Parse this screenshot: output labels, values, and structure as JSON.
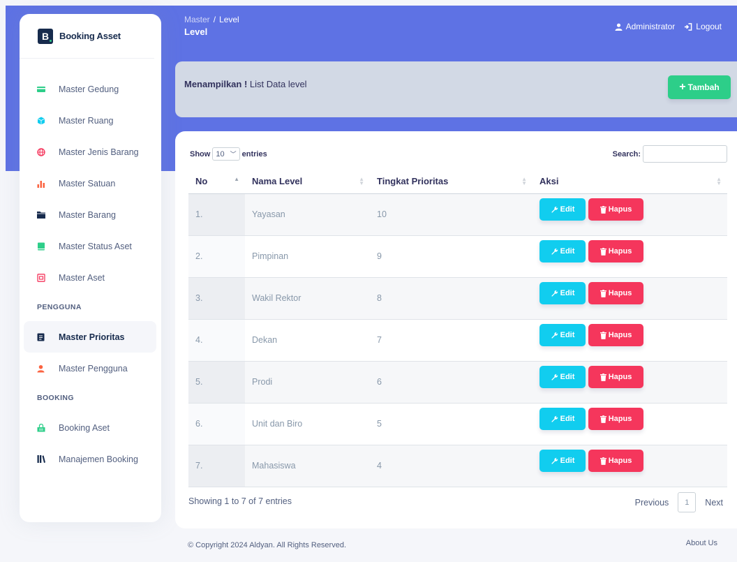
{
  "brand": {
    "letter": "B",
    "name": "Booking Asset"
  },
  "sidebar": {
    "items": [
      {
        "label": "Master Gedung",
        "icon": "credit-card-icon",
        "color": "#2dce89"
      },
      {
        "label": "Master Ruang",
        "icon": "cube-icon",
        "color": "#11cdef"
      },
      {
        "label": "Master Jenis Barang",
        "icon": "globe-icon",
        "color": "#f5365c"
      },
      {
        "label": "Master Satuan",
        "icon": "bar-chart-icon",
        "color": "#fb6340"
      },
      {
        "label": "Master Barang",
        "icon": "folder-icon",
        "color": "#172b4d"
      },
      {
        "label": "Master Status Aset",
        "icon": "book-icon",
        "color": "#2dce89"
      },
      {
        "label": "Master Aset",
        "icon": "archive-icon",
        "color": "#f5365c"
      }
    ],
    "heading_pengguna": "PENGGUNA",
    "pengguna_items": [
      {
        "label": "Master Prioritas",
        "icon": "clipboard-icon",
        "color": "#172b4d",
        "active": true
      },
      {
        "label": "Master Pengguna",
        "icon": "user-icon",
        "color": "#fb6340"
      }
    ],
    "heading_booking": "BOOKING",
    "booking_items": [
      {
        "label": "Booking Aset",
        "icon": "basket-icon",
        "color": "#2dce89"
      },
      {
        "label": "Manajemen Booking",
        "icon": "library-icon",
        "color": "#172b4d"
      }
    ]
  },
  "header": {
    "breadcrumb_root": "Master",
    "breadcrumb_sep": "/",
    "breadcrumb_current": "Level",
    "title": "Level",
    "user": "Administrator",
    "logout": "Logout"
  },
  "info": {
    "bold": "Menampilkan !",
    "text": " List Data level",
    "add_label": "Tambah"
  },
  "datatable": {
    "show": "Show",
    "length": "10",
    "entries": "entries",
    "search_label": "Search:",
    "columns": [
      "No",
      "Nama Level",
      "Tingkat Prioritas",
      "Aksi"
    ],
    "rows": [
      {
        "no": "1.",
        "nama": "Yayasan",
        "prioritas": "10"
      },
      {
        "no": "2.",
        "nama": "Pimpinan",
        "prioritas": "9"
      },
      {
        "no": "3.",
        "nama": "Wakil Rektor",
        "prioritas": "8"
      },
      {
        "no": "4.",
        "nama": "Dekan",
        "prioritas": "7"
      },
      {
        "no": "5.",
        "nama": "Prodi",
        "prioritas": "6"
      },
      {
        "no": "6.",
        "nama": "Unit dan Biro",
        "prioritas": "5"
      },
      {
        "no": "7.",
        "nama": "Mahasiswa",
        "prioritas": "4"
      }
    ],
    "edit_label": "Edit",
    "delete_label": "Hapus",
    "info": "Showing 1 to 7 of 7 entries",
    "previous": "Previous",
    "page": "1",
    "next": "Next"
  },
  "footer": {
    "copyright": "© Copyright 2024 Aldyan. All Rights Reserved.",
    "about": "About Us"
  }
}
